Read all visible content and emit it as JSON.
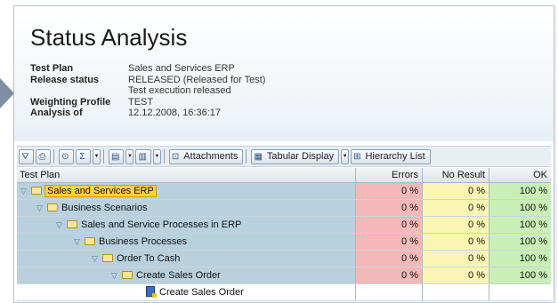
{
  "header": {
    "title": "Status Analysis",
    "fields": [
      {
        "label": "Test Plan",
        "value": "Sales and Services ERP"
      },
      {
        "label": "Release status",
        "value": "RELEASED (Released for Test)"
      },
      {
        "label": "",
        "value": "Test execution released"
      },
      {
        "label": "Weighting Profile",
        "value": "TEST"
      },
      {
        "label": "Analysis of",
        "value": "12.12.2008, 16:36:17"
      }
    ]
  },
  "toolbar": {
    "attachments_label": "Attachments",
    "tabular_display_label": "Tabular Display",
    "hierarchy_list_label": "Hierarchy List"
  },
  "table": {
    "columns": {
      "plan": "Test Plan",
      "errors": "Errors",
      "no_result": "No Result",
      "ok": "OK"
    },
    "rows": [
      {
        "name": "Sales and Services ERP",
        "errors": "0 %",
        "no_result": "0 %",
        "ok": "100 %",
        "level": 0
      },
      {
        "name": "Business Scenarios",
        "errors": "0 %",
        "no_result": "0 %",
        "ok": "100 %",
        "level": 1
      },
      {
        "name": "Sales and Service Processes in ERP",
        "errors": "0 %",
        "no_result": "0 %",
        "ok": "100 %",
        "level": 2
      },
      {
        "name": "Business Processes",
        "errors": "0 %",
        "no_result": "0 %",
        "ok": "100 %",
        "level": 3
      },
      {
        "name": "Order To Cash",
        "errors": "0 %",
        "no_result": "0 %",
        "ok": "100 %",
        "level": 4
      },
      {
        "name": "Create Sales Order",
        "errors": "0 %",
        "no_result": "0 %",
        "ok": "100 %",
        "level": 5
      },
      {
        "name": "Create Sales Order",
        "errors": "",
        "no_result": "",
        "ok": "",
        "level": 6
      }
    ]
  },
  "colors": {
    "errors": "#f4b8b8",
    "no_result": "#f9f6b4",
    "ok": "#c8efb6",
    "tree": "#b9d1df"
  }
}
